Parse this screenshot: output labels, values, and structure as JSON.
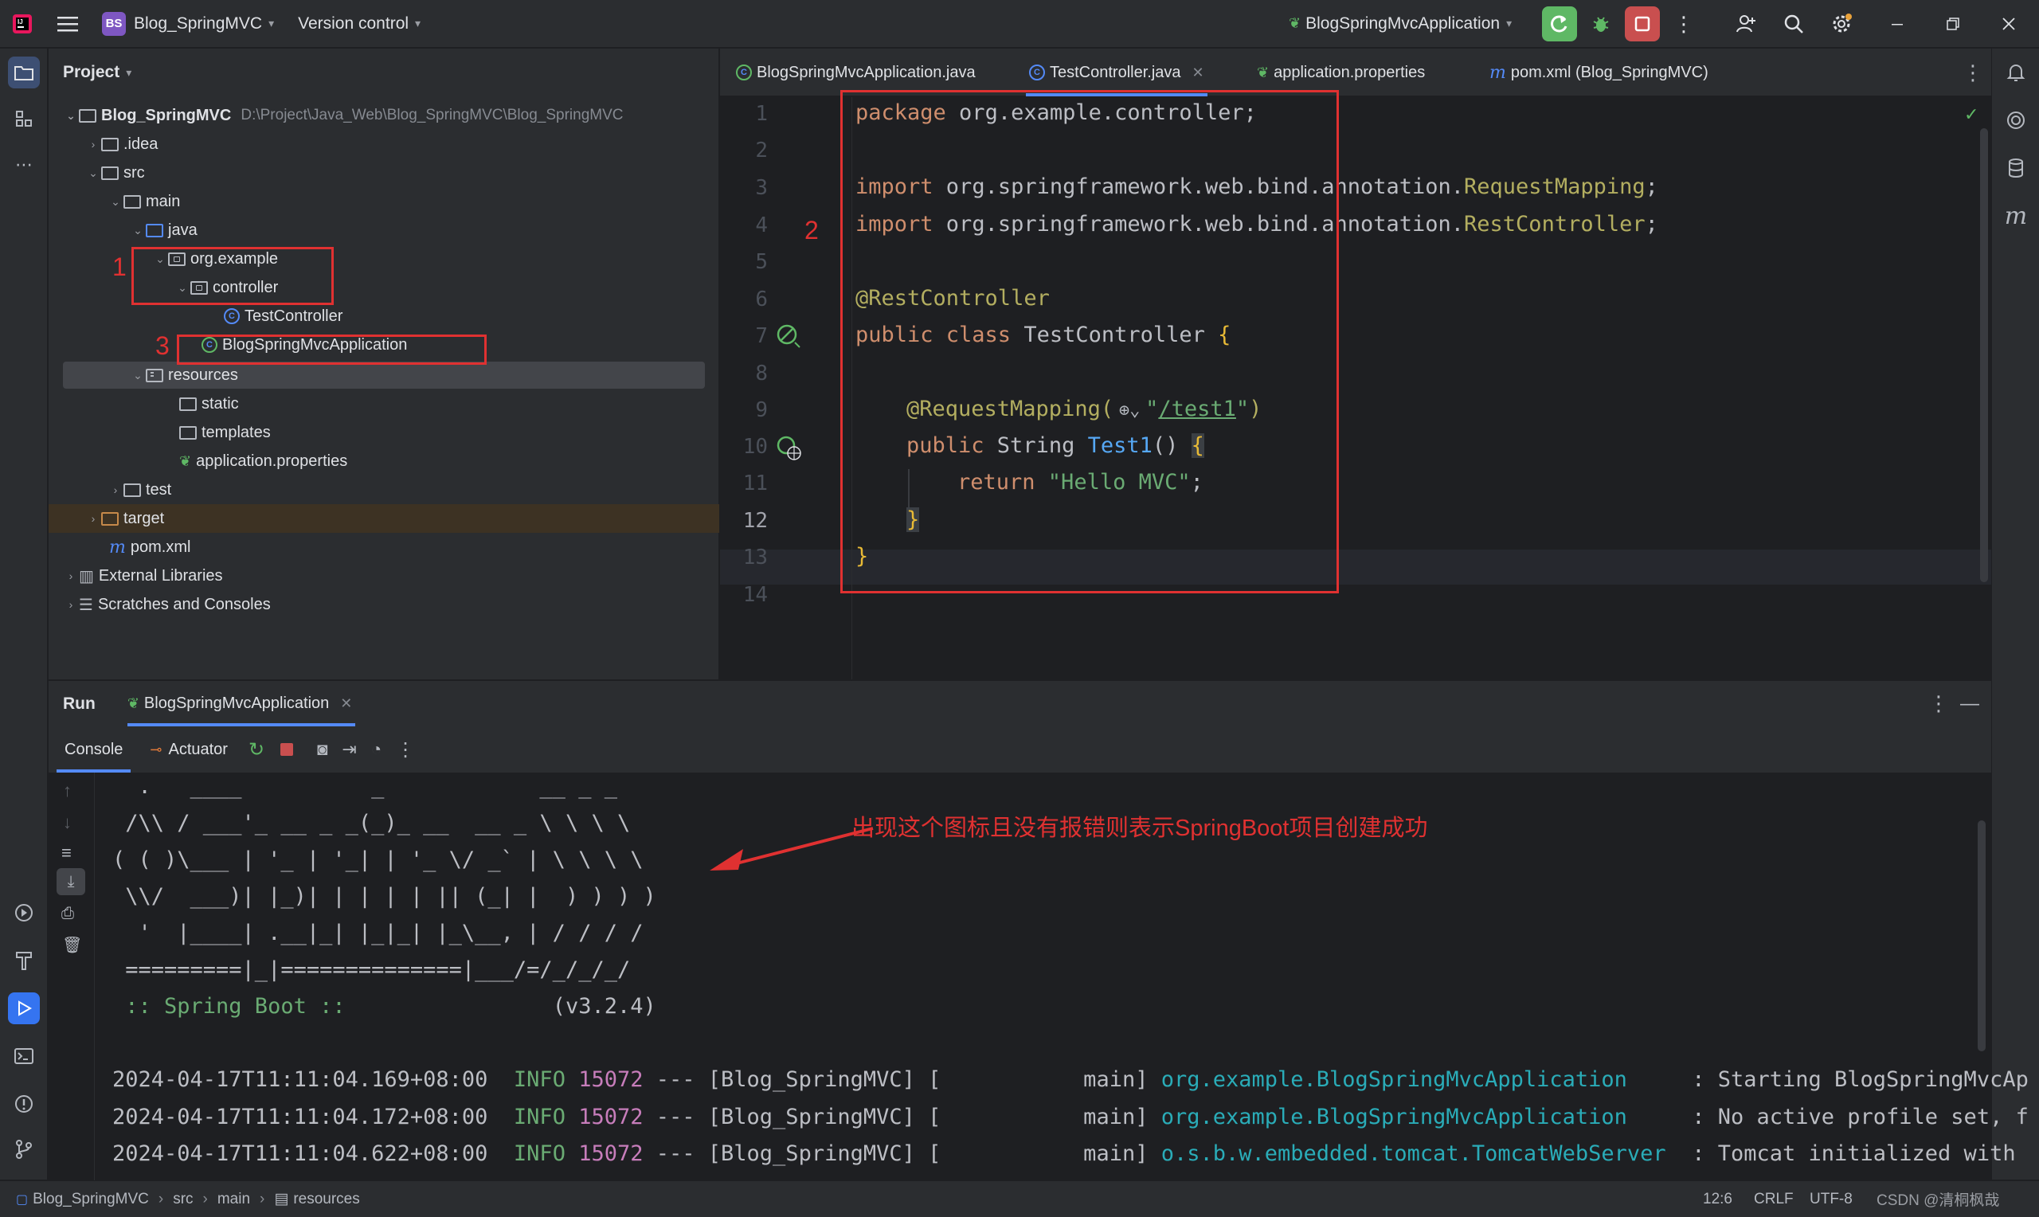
{
  "titlebar": {
    "project_badge": "BS",
    "project_name": "Blog_SpringMVC",
    "vcs": "Version control",
    "run_config": "BlogSpringMvcApplication"
  },
  "project_pane": {
    "title": "Project",
    "tree": [
      {
        "label": "Blog_SpringMVC",
        "path": "D:\\Project\\Java_Web\\Blog_SpringMVC\\Blog_SpringMVC"
      },
      {
        "label": ".idea"
      },
      {
        "label": "src"
      },
      {
        "label": "main"
      },
      {
        "label": "java"
      },
      {
        "label": "org.example"
      },
      {
        "label": "controller"
      },
      {
        "label": "TestController"
      },
      {
        "label": "BlogSpringMvcApplication"
      },
      {
        "label": "resources"
      },
      {
        "label": "static"
      },
      {
        "label": "templates"
      },
      {
        "label": "application.properties"
      },
      {
        "label": "test"
      },
      {
        "label": "target"
      },
      {
        "label": "pom.xml"
      },
      {
        "label": "External Libraries"
      },
      {
        "label": "Scratches and Consoles"
      }
    ]
  },
  "editor": {
    "tabs": [
      {
        "label": "BlogSpringMvcApplication.java"
      },
      {
        "label": "TestController.java"
      },
      {
        "label": "application.properties"
      },
      {
        "label": "pom.xml (Blog_SpringMVC)"
      }
    ],
    "line_numbers": [
      "1",
      "2",
      "3",
      "4",
      "5",
      "6",
      "7",
      "8",
      "9",
      "10",
      "11",
      "12",
      "13",
      "14"
    ],
    "code": {
      "l1_kw": "package",
      "l1_rest": " org.example.controller;",
      "l3_kw": "import",
      "l3_pkg": " org.springframework.web.bind.annotation.",
      "l3_cls": "RequestMapping",
      "l4_kw": "import",
      "l4_pkg": " org.springframework.web.bind.annotation.",
      "l4_cls": "RestController",
      "semi": ";",
      "l6_ann": "@RestController",
      "l7_kw": "public class",
      "l7_rest": " TestController ",
      "brace_open": "{",
      "l9_ann": "@RequestMapping(",
      "l9_q1": "\"",
      "l9_url": "/test1",
      "l9_q2": "\"",
      "l9_close": ")",
      "l10_kw": "public",
      "l10_type": " String ",
      "l10_fn": "Test1",
      "l10_parens": "() ",
      "l11_kw": "return",
      "l11_str": " \"Hello MVC\"",
      "brace_close": "}"
    }
  },
  "annotations": {
    "label1": "1",
    "label2": "2",
    "label3": "3",
    "note": "出现这个图标且没有报错则表示SpringBoot项目创建成功"
  },
  "run_pane": {
    "title": "Run",
    "tab_label": "BlogSpringMvcApplication",
    "console_tab": "Console",
    "actuator_tab": "Actuator",
    "banner": [
      "  .   ____          _            __ _ _",
      " /\\\\ / ___'_ __ _ _(_)_ __  __ _ \\ \\ \\ \\",
      "( ( )\\___ | '_ | '_| | '_ \\/ _` | \\ \\ \\ \\",
      " \\\\/  ___)| |_)| | | | | || (_| |  ) ) ) )",
      "  '  |____| .__|_| |_|_| |_\\__, | / / / /",
      " =========|_|==============|___/=/_/_/_/"
    ],
    "spring_boot_label": " :: Spring Boot ::",
    "spring_boot_version": "                (v3.2.4)",
    "logs": [
      {
        "ts": "2024-04-17T11:11:04.169+08:00",
        "level": "INFO",
        "pid": "15072",
        "sep": " --- [Blog_SpringMVC] [           main] ",
        "logger": "org.example.BlogSpringMvcApplication",
        "msg": "     : Starting BlogSpringMvcAp"
      },
      {
        "ts": "2024-04-17T11:11:04.172+08:00",
        "level": "INFO",
        "pid": "15072",
        "sep": " --- [Blog_SpringMVC] [           main] ",
        "logger": "org.example.BlogSpringMvcApplication",
        "msg": "     : No active profile set, f"
      },
      {
        "ts": "2024-04-17T11:11:04.622+08:00",
        "level": "INFO",
        "pid": "15072",
        "sep": " --- [Blog_SpringMVC] [           main] ",
        "logger": "o.s.b.w.embedded.tomcat.TomcatWebServer",
        "msg": "  : Tomcat initialized with"
      }
    ]
  },
  "statusbar": {
    "crumb1": "Blog_SpringMVC",
    "crumb2": "src",
    "crumb3": "main",
    "crumb4": "resources",
    "position": "12:6",
    "line_sep": "CRLF",
    "encoding": "UTF-8",
    "watermark": "CSDN @清桐枫哉"
  },
  "colors": {
    "accent": "#548af7",
    "annotation_red": "#e03131",
    "run_green": "#5fb865",
    "stop_red": "#c94f4f"
  }
}
